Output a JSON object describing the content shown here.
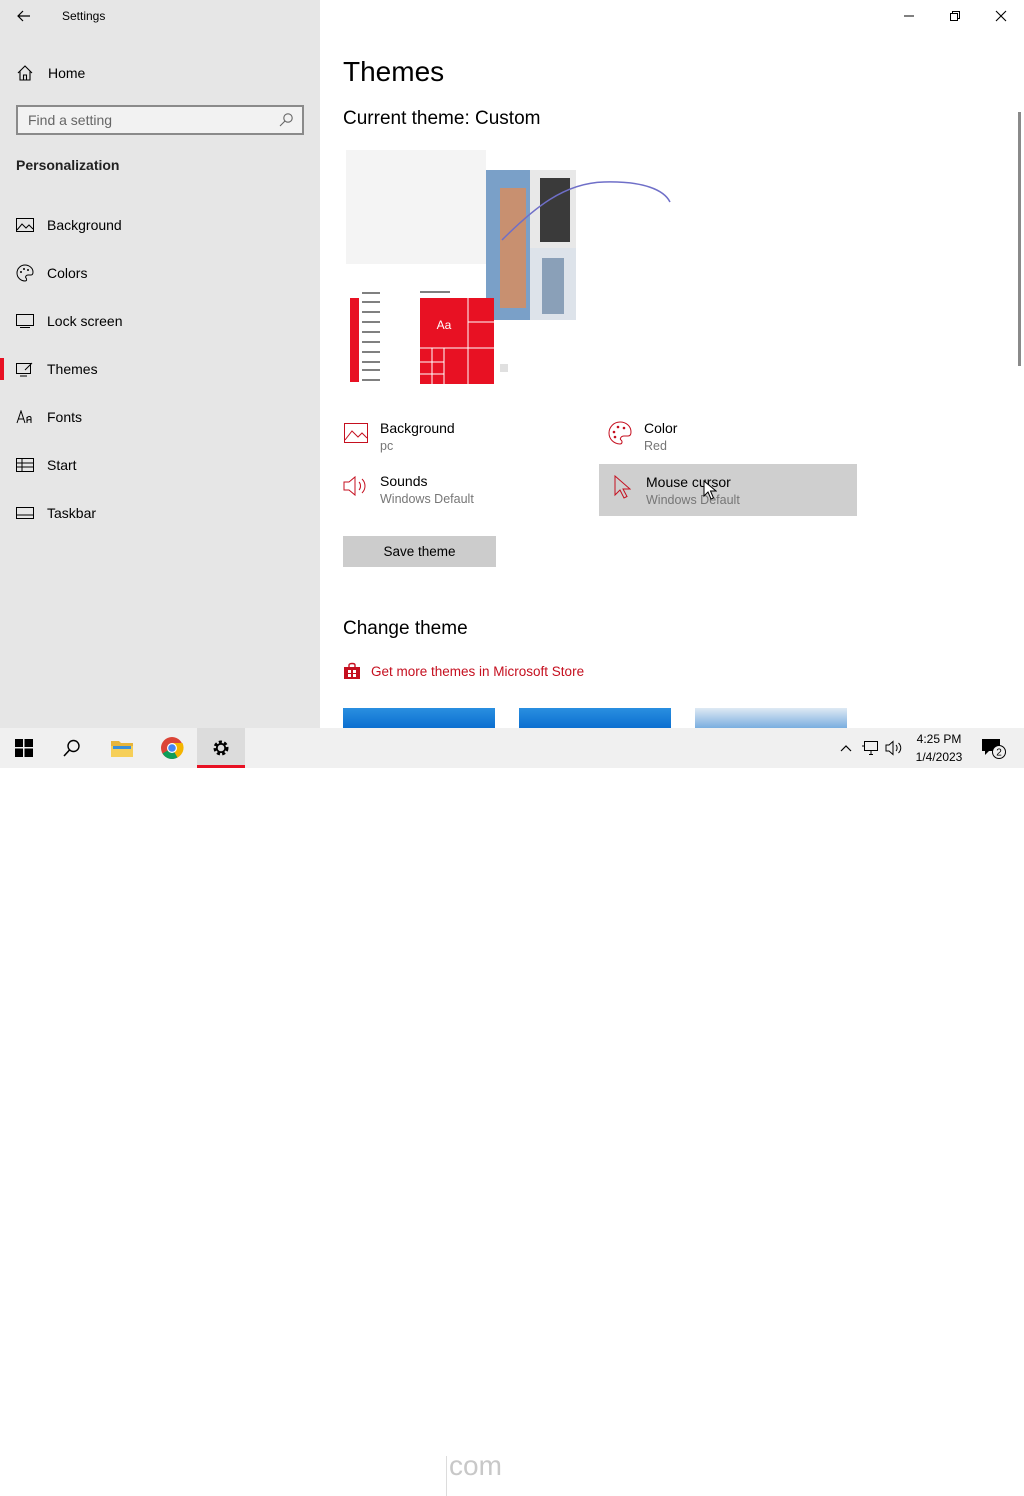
{
  "window": {
    "title": "Settings"
  },
  "sidebar": {
    "home_label": "Home",
    "search_placeholder": "Find a setting",
    "section_title": "Personalization",
    "items": [
      {
        "label": "Background",
        "icon": "image-icon"
      },
      {
        "label": "Colors",
        "icon": "palette-icon"
      },
      {
        "label": "Lock screen",
        "icon": "lock-screen-icon"
      },
      {
        "label": "Themes",
        "icon": "themes-icon",
        "active": true
      },
      {
        "label": "Fonts",
        "icon": "fonts-icon"
      },
      {
        "label": "Start",
        "icon": "start-icon"
      },
      {
        "label": "Taskbar",
        "icon": "taskbar-icon"
      }
    ]
  },
  "main": {
    "page_title": "Themes",
    "current_theme_label": "Current theme: Custom",
    "preview_tile_text": "Aa",
    "properties": {
      "background": {
        "title": "Background",
        "value": "pc"
      },
      "color": {
        "title": "Color",
        "value": "Red"
      },
      "sounds": {
        "title": "Sounds",
        "value": "Windows Default"
      },
      "mouse_cursor": {
        "title": "Mouse cursor",
        "value": "Windows Default"
      }
    },
    "save_button": "Save theme",
    "change_theme_heading": "Change theme",
    "store_link": "Get more themes in Microsoft Store"
  },
  "taskbar": {
    "time": "4:25 PM",
    "date": "1/4/2023",
    "notification_count": "2",
    "watermark": "com"
  },
  "colors": {
    "accent": "#e81123",
    "link": "#c50f1f",
    "sidebar_bg": "#e6e6e6"
  }
}
